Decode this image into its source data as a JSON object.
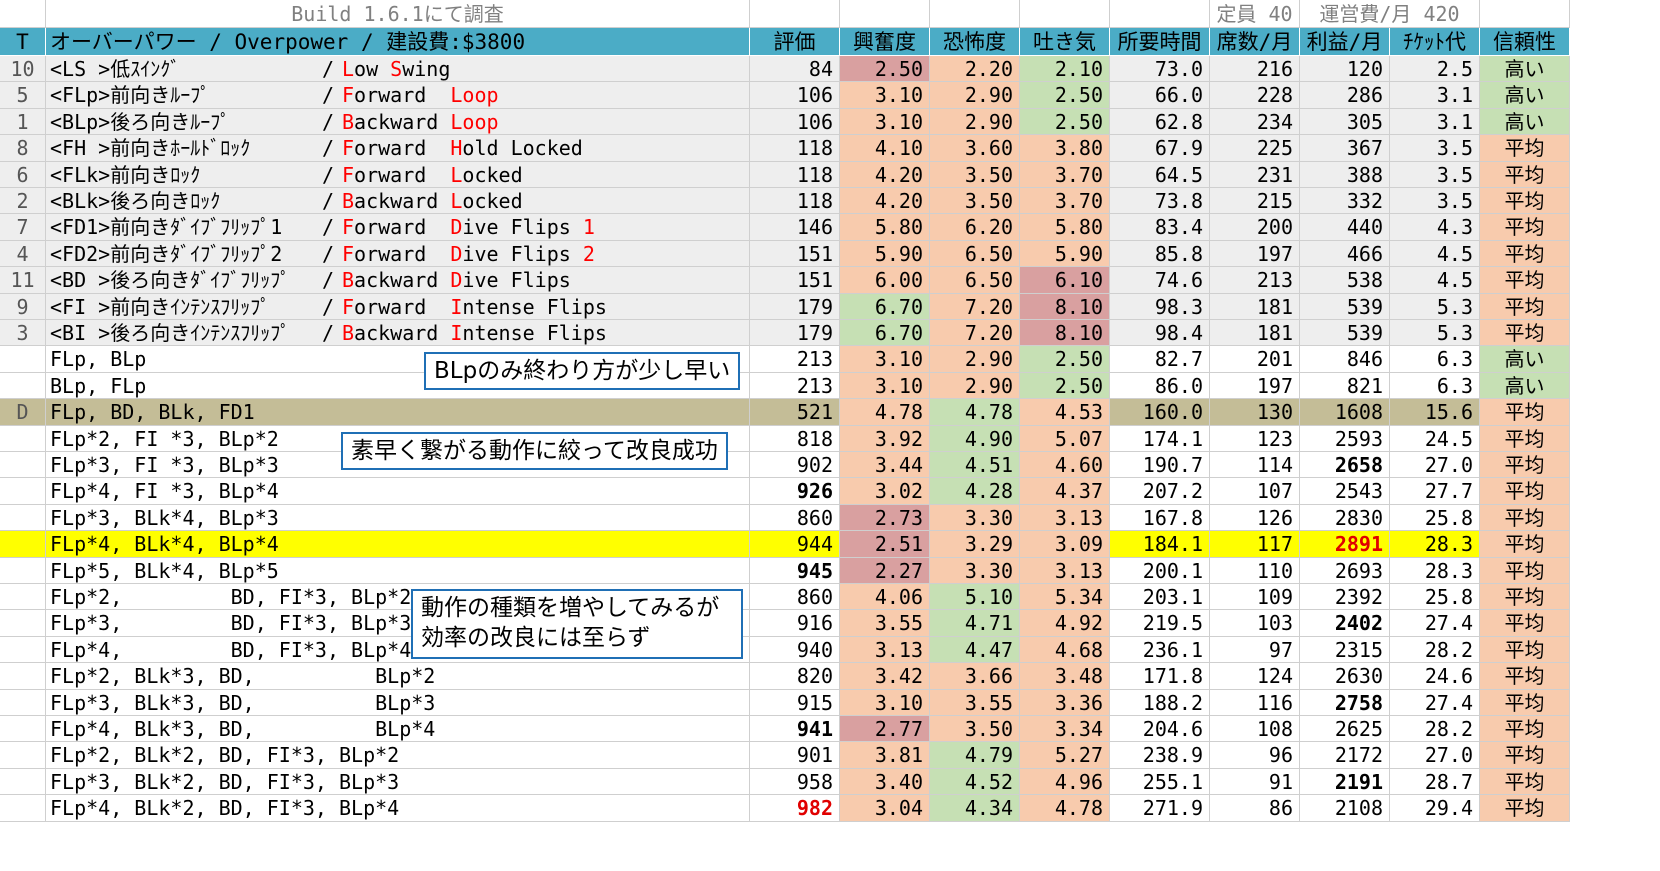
{
  "top": {
    "build": "Build 1.6.1にて調査",
    "capacity": "定員 40",
    "cost": "運営費/月 420"
  },
  "header": {
    "t": "T",
    "title": "オーバーパワー / Overpower / 建設費:$3800",
    "cols": [
      "評価",
      "興奮度",
      "恐怖度",
      "吐き気",
      "所要時間",
      "席数/月",
      "利益/月",
      "ﾁｹｯﾄ代",
      "信頼性"
    ]
  },
  "colors": {
    "header_bg": "#4bacc6",
    "orange": "#f8cbad",
    "green": "#c6e0b4",
    "pink": "#d9a0a0",
    "gray": "#eeeeee",
    "olive": "#c4bd97",
    "yellow": "#ffff00",
    "red_text": "#ff0000"
  },
  "rows": [
    {
      "t": "10",
      "jp": "<LS >低ｽｲﾝｸﾞ",
      "en": [
        [
          "L",
          1
        ],
        [
          "ow ",
          0
        ],
        [
          "S",
          1
        ],
        [
          "wing",
          0
        ]
      ],
      "v": [
        "84",
        "2.50",
        "2.20",
        "2.10",
        "73.0",
        "216",
        "120",
        "2.5",
        "高い"
      ],
      "ex": "pink",
      "sc": "orange",
      "na": "green",
      "rel": "green",
      "bg": "gray"
    },
    {
      "t": "5",
      "jp": "<FLp>前向きﾙｰﾌﾟ",
      "en": [
        [
          "F",
          1
        ],
        [
          "orward  ",
          0
        ],
        [
          "L",
          1
        ],
        [
          "oop",
          1
        ]
      ],
      "v": [
        "106",
        "3.10",
        "2.90",
        "2.50",
        "66.0",
        "228",
        "286",
        "3.1",
        "高い"
      ],
      "ex": "orange",
      "sc": "orange",
      "na": "green",
      "rel": "green",
      "bg": "gray"
    },
    {
      "t": "1",
      "jp": "<BLp>後ろ向きﾙｰﾌﾟ",
      "en": [
        [
          "B",
          1
        ],
        [
          "ackward ",
          0
        ],
        [
          "L",
          1
        ],
        [
          "oop",
          1
        ]
      ],
      "v": [
        "106",
        "3.10",
        "2.90",
        "2.50",
        "62.8",
        "234",
        "305",
        "3.1",
        "高い"
      ],
      "ex": "orange",
      "sc": "orange",
      "na": "green",
      "rel": "green",
      "bg": "gray"
    },
    {
      "t": "8",
      "jp": "<FH >前向きﾎｰﾙﾄﾞﾛｯｸ",
      "en": [
        [
          "F",
          1
        ],
        [
          "orward  ",
          0
        ],
        [
          "H",
          1
        ],
        [
          "old Locked",
          0
        ]
      ],
      "v": [
        "118",
        "4.10",
        "3.60",
        "3.80",
        "67.9",
        "225",
        "367",
        "3.5",
        "平均"
      ],
      "ex": "orange",
      "sc": "orange",
      "na": "orange",
      "rel": "orange",
      "bg": "gray"
    },
    {
      "t": "6",
      "jp": "<FLk>前向きﾛｯｸ",
      "en": [
        [
          "F",
          1
        ],
        [
          "orward  ",
          0
        ],
        [
          "L",
          1
        ],
        [
          "ocked",
          0
        ]
      ],
      "v": [
        "118",
        "4.20",
        "3.50",
        "3.70",
        "64.5",
        "231",
        "388",
        "3.5",
        "平均"
      ],
      "ex": "orange",
      "sc": "orange",
      "na": "orange",
      "rel": "orange",
      "bg": "gray"
    },
    {
      "t": "2",
      "jp": "<BLk>後ろ向きﾛｯｸ",
      "en": [
        [
          "B",
          1
        ],
        [
          "ackward ",
          0
        ],
        [
          "L",
          1
        ],
        [
          "ocked",
          0
        ]
      ],
      "v": [
        "118",
        "4.20",
        "3.50",
        "3.70",
        "73.8",
        "215",
        "332",
        "3.5",
        "平均"
      ],
      "ex": "orange",
      "sc": "orange",
      "na": "orange",
      "rel": "orange",
      "bg": "gray"
    },
    {
      "t": "7",
      "jp": "<FD1>前向きﾀﾞｲﾌﾞﾌﾘｯﾌﾟ1",
      "en": [
        [
          "F",
          1
        ],
        [
          "orward  ",
          0
        ],
        [
          "D",
          1
        ],
        [
          "ive Flips ",
          0
        ],
        [
          "1",
          1
        ]
      ],
      "v": [
        "146",
        "5.80",
        "6.20",
        "5.80",
        "83.4",
        "200",
        "440",
        "4.3",
        "平均"
      ],
      "ex": "orange",
      "sc": "orange",
      "na": "orange",
      "rel": "orange",
      "bg": "gray"
    },
    {
      "t": "4",
      "jp": "<FD2>前向きﾀﾞｲﾌﾞﾌﾘｯﾌﾟ2",
      "en": [
        [
          "F",
          1
        ],
        [
          "orward  ",
          0
        ],
        [
          "D",
          1
        ],
        [
          "ive Flips ",
          0
        ],
        [
          "2",
          1
        ]
      ],
      "v": [
        "151",
        "5.90",
        "6.50",
        "5.90",
        "85.8",
        "197",
        "466",
        "4.5",
        "平均"
      ],
      "ex": "orange",
      "sc": "orange",
      "na": "orange",
      "rel": "orange",
      "bg": "gray"
    },
    {
      "t": "11",
      "jp": "<BD >後ろ向きﾀﾞｲﾌﾞﾌﾘｯﾌﾟ",
      "en": [
        [
          "B",
          1
        ],
        [
          "ackward ",
          0
        ],
        [
          "D",
          1
        ],
        [
          "ive Flips",
          0
        ]
      ],
      "v": [
        "151",
        "6.00",
        "6.50",
        "6.10",
        "74.6",
        "213",
        "538",
        "4.5",
        "平均"
      ],
      "ex": "orange",
      "sc": "orange",
      "na": "pink",
      "rel": "orange",
      "bg": "gray"
    },
    {
      "t": "9",
      "jp": "<FI >前向きｲﾝﾃﾝｽﾌﾘｯﾌﾟ",
      "en": [
        [
          "F",
          1
        ],
        [
          "orward  ",
          0
        ],
        [
          "I",
          1
        ],
        [
          "ntense Flips",
          0
        ]
      ],
      "v": [
        "179",
        "6.70",
        "7.20",
        "8.10",
        "98.3",
        "181",
        "539",
        "5.3",
        "平均"
      ],
      "ex": "green",
      "sc": "orange",
      "na": "pink",
      "rel": "orange",
      "bg": "gray"
    },
    {
      "t": "3",
      "jp": "<BI >後ろ向きｲﾝﾃﾝｽﾌﾘｯﾌﾟ",
      "en": [
        [
          "B",
          1
        ],
        [
          "ackward ",
          0
        ],
        [
          "I",
          1
        ],
        [
          "ntense Flips",
          0
        ]
      ],
      "v": [
        "179",
        "6.70",
        "7.20",
        "8.10",
        "98.4",
        "181",
        "539",
        "5.3",
        "平均"
      ],
      "ex": "green",
      "sc": "orange",
      "na": "pink",
      "rel": "orange",
      "bg": "gray"
    },
    {
      "t": "",
      "jp": "FLp, BLp",
      "v": [
        "213",
        "3.10",
        "2.90",
        "2.50",
        "82.7",
        "201",
        "846",
        "6.3",
        "高い"
      ],
      "ex": "orange",
      "sc": "orange",
      "na": "green",
      "rel": "green",
      "bg": "white"
    },
    {
      "t": "",
      "jp": "BLp, FLp",
      "v": [
        "213",
        "3.10",
        "2.90",
        "2.50",
        "86.0",
        "197",
        "821",
        "6.3",
        "高い"
      ],
      "ex": "orange",
      "sc": "orange",
      "na": "green",
      "rel": "green",
      "bg": "white"
    },
    {
      "t": "D",
      "jp": "FLp, BD, BLk, FD1",
      "v": [
        "521",
        "4.78",
        "4.78",
        "4.53",
        "160.0",
        "130",
        "1608",
        "15.6",
        "平均"
      ],
      "ex": "orange",
      "sc": "green",
      "na": "orange",
      "rel": "orange",
      "bg": "olive"
    },
    {
      "t": "",
      "jp": "FLp*2, FI *3, BLp*2",
      "v": [
        "818",
        "3.92",
        "4.90",
        "5.07",
        "174.1",
        "123",
        "2593",
        "24.5",
        "平均"
      ],
      "ex": "orange",
      "sc": "green",
      "na": "orange",
      "rel": "orange",
      "bg": "white"
    },
    {
      "t": "",
      "jp": "FLp*3, FI *3, BLp*3",
      "v": [
        "902",
        "3.44",
        "4.51",
        "4.60",
        "190.7",
        "114",
        "2658",
        "27.0",
        "平均"
      ],
      "ex": "orange",
      "sc": "green",
      "na": "orange",
      "rel": "orange",
      "bg": "white",
      "boldIdx": [
        6
      ]
    },
    {
      "t": "",
      "jp": "FLp*4, FI *3, BLp*4",
      "v": [
        "926",
        "3.02",
        "4.28",
        "4.37",
        "207.2",
        "107",
        "2543",
        "27.7",
        "平均"
      ],
      "ex": "orange",
      "sc": "green",
      "na": "orange",
      "rel": "orange",
      "bg": "white",
      "boldIdx": [
        0
      ]
    },
    {
      "t": "",
      "jp": "FLp*3, BLk*4, BLp*3",
      "v": [
        "860",
        "2.73",
        "3.30",
        "3.13",
        "167.8",
        "126",
        "2830",
        "25.8",
        "平均"
      ],
      "ex": "pink",
      "sc": "orange",
      "na": "orange",
      "rel": "orange",
      "bg": "white"
    },
    {
      "t": "",
      "jp": "FLp*4, BLk*4, BLp*4",
      "v": [
        "944",
        "2.51",
        "3.29",
        "3.09",
        "184.1",
        "117",
        "2891",
        "28.3",
        "平均"
      ],
      "ex": "pink",
      "sc": "orange",
      "na": "orange",
      "rel": "orange",
      "bg": "yellow",
      "boldIdx": [
        6
      ],
      "redIdx": [
        6
      ]
    },
    {
      "t": "",
      "jp": "FLp*5, BLk*4, BLp*5",
      "v": [
        "945",
        "2.27",
        "3.30",
        "3.13",
        "200.1",
        "110",
        "2693",
        "28.3",
        "平均"
      ],
      "ex": "pink",
      "sc": "orange",
      "na": "orange",
      "rel": "orange",
      "bg": "white",
      "boldIdx": [
        0
      ]
    },
    {
      "t": "",
      "jp": "FLp*2,         BD, FI*3, BLp*2",
      "v": [
        "860",
        "4.06",
        "5.10",
        "5.34",
        "203.1",
        "109",
        "2392",
        "25.8",
        "平均"
      ],
      "ex": "orange",
      "sc": "green",
      "na": "orange",
      "rel": "orange",
      "bg": "white"
    },
    {
      "t": "",
      "jp": "FLp*3,         BD, FI*3, BLp*3",
      "v": [
        "916",
        "3.55",
        "4.71",
        "4.92",
        "219.5",
        "103",
        "2402",
        "27.4",
        "平均"
      ],
      "ex": "orange",
      "sc": "green",
      "na": "orange",
      "rel": "orange",
      "bg": "white",
      "boldIdx": [
        6
      ]
    },
    {
      "t": "",
      "jp": "FLp*4,         BD, FI*3, BLp*4",
      "v": [
        "940",
        "3.13",
        "4.47",
        "4.68",
        "236.1",
        "97",
        "2315",
        "28.2",
        "平均"
      ],
      "ex": "orange",
      "sc": "green",
      "na": "orange",
      "rel": "orange",
      "bg": "white"
    },
    {
      "t": "",
      "jp": "FLp*2, BLk*3, BD,          BLp*2",
      "v": [
        "820",
        "3.42",
        "3.66",
        "3.48",
        "171.8",
        "124",
        "2630",
        "24.6",
        "平均"
      ],
      "ex": "orange",
      "sc": "orange",
      "na": "orange",
      "rel": "orange",
      "bg": "white"
    },
    {
      "t": "",
      "jp": "FLp*3, BLk*3, BD,          BLp*3",
      "v": [
        "915",
        "3.10",
        "3.55",
        "3.36",
        "188.2",
        "116",
        "2758",
        "27.4",
        "平均"
      ],
      "ex": "orange",
      "sc": "orange",
      "na": "orange",
      "rel": "orange",
      "bg": "white",
      "boldIdx": [
        6
      ]
    },
    {
      "t": "",
      "jp": "FLp*4, BLk*3, BD,          BLp*4",
      "v": [
        "941",
        "2.77",
        "3.50",
        "3.34",
        "204.6",
        "108",
        "2625",
        "28.2",
        "平均"
      ],
      "ex": "pink",
      "sc": "orange",
      "na": "orange",
      "rel": "orange",
      "bg": "white",
      "boldIdx": [
        0
      ]
    },
    {
      "t": "",
      "jp": "FLp*2, BLk*2, BD, FI*3, BLp*2",
      "v": [
        "901",
        "3.81",
        "4.79",
        "5.27",
        "238.9",
        "96",
        "2172",
        "27.0",
        "平均"
      ],
      "ex": "orange",
      "sc": "green",
      "na": "orange",
      "rel": "orange",
      "bg": "white"
    },
    {
      "t": "",
      "jp": "FLp*3, BLk*2, BD, FI*3, BLp*3",
      "v": [
        "958",
        "3.40",
        "4.52",
        "4.96",
        "255.1",
        "91",
        "2191",
        "28.7",
        "平均"
      ],
      "ex": "orange",
      "sc": "green",
      "na": "orange",
      "rel": "orange",
      "bg": "white",
      "boldIdx": [
        6
      ]
    },
    {
      "t": "",
      "jp": "FLp*4, BLk*2, BD, FI*3, BLp*4",
      "v": [
        "982",
        "3.04",
        "4.34",
        "4.78",
        "271.9",
        "86",
        "2108",
        "29.4",
        "平均"
      ],
      "ex": "orange",
      "sc": "green",
      "na": "orange",
      "rel": "orange",
      "bg": "white",
      "boldIdx": [
        0
      ],
      "redIdx": [
        0
      ]
    }
  ],
  "notes": [
    "BLpのみ終わり方が少し早い",
    "素早く繋がる動作に絞って改良成功",
    "動作の種類を増やしてみるが\n効率の改良には至らず"
  ]
}
